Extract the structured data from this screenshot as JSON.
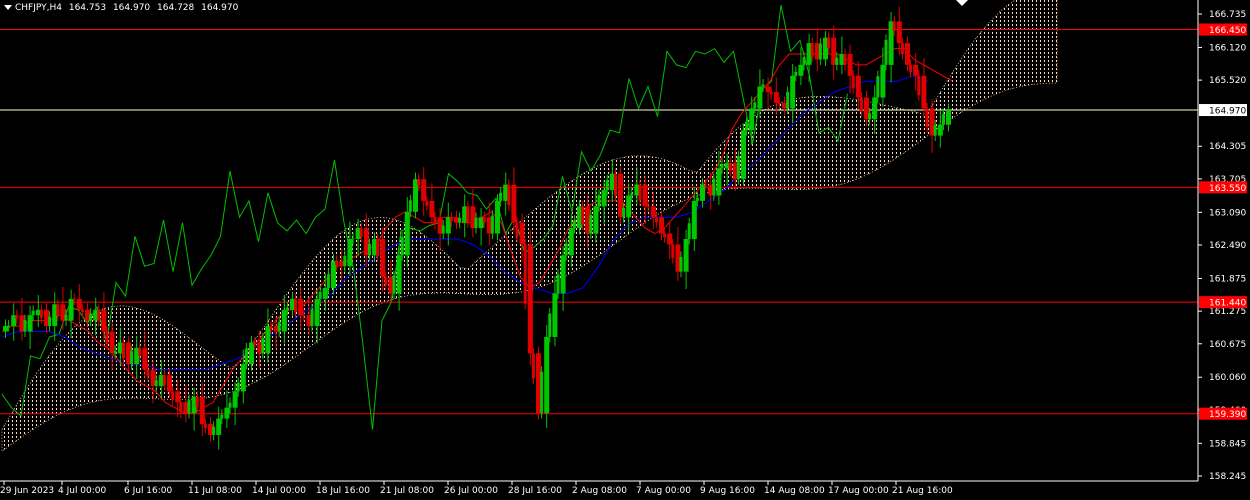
{
  "header": {
    "symbol": "CHFJPY,H4",
    "open": "164.753",
    "high": "164.970",
    "low": "164.728",
    "close": "164.970"
  },
  "colors": {
    "background": "#000000",
    "axis": "#ffffff",
    "bull_candle": "#00c800",
    "bear_candle": "#e00000",
    "tenkan_sen": "#ff0000",
    "kijun_sen": "#0000ff",
    "chikou_span": "#00c000",
    "cloud": "#ffd8b8",
    "hline": "#ff0000",
    "price_line": "#ffffcc"
  },
  "icons": {
    "menu": "triangle-down-icon",
    "shift": "triangle-down-icon"
  },
  "chart_data": {
    "type": "candlestick",
    "symbol": "CHFJPY",
    "timeframe": "H4",
    "indicator": "ichimoku",
    "ylim": [
      158.245,
      166.9
    ],
    "y_ticks": [
      "166.735",
      "166.120",
      "165.520",
      "164.305",
      "163.705",
      "163.090",
      "162.490",
      "161.875",
      "161.275",
      "160.675",
      "160.060",
      "159.460",
      "158.845",
      "158.245"
    ],
    "x_ticks": [
      "29 Jun 2023",
      "4 Jul 00:00",
      "6 Jul 16:00",
      "11 Jul 08:00",
      "14 Jul 00:00",
      "18 Jul 16:00",
      "21 Jul 08:00",
      "26 Jul 00:00",
      "28 Jul 16:00",
      "2 Aug 08:00",
      "7 Aug 00:00",
      "9 Aug 16:00",
      "14 Aug 08:00",
      "17 Aug 00:00",
      "21 Aug 16:00"
    ],
    "hlines": [
      {
        "value": 166.45,
        "label": "166.450",
        "color": "#ff0000"
      },
      {
        "value": 163.55,
        "label": "163.550",
        "color": "#ff0000"
      },
      {
        "value": 161.44,
        "label": "161.440",
        "color": "#ff0000"
      },
      {
        "value": 159.39,
        "label": "159.390",
        "color": "#ff0000"
      }
    ],
    "current_price": {
      "value": 164.97,
      "label": "164.970"
    },
    "closes": [
      161.0,
      161.2,
      160.9,
      161.2,
      161.3,
      161.0,
      161.4,
      161.1,
      161.5,
      161.3,
      161.1,
      161.3,
      160.9,
      160.5,
      160.7,
      160.3,
      160.6,
      160.2,
      159.9,
      160.1,
      159.8,
      159.6,
      159.4,
      159.7,
      159.2,
      159.0,
      159.3,
      159.5,
      159.8,
      160.3,
      160.7,
      160.5,
      161.0,
      160.9,
      161.3,
      161.5,
      161.2,
      161.0,
      161.5,
      161.7,
      162.2,
      162.1,
      162.6,
      162.8,
      162.3,
      162.6,
      161.9,
      161.6,
      162.3,
      163.1,
      163.7,
      163.3,
      163.0,
      162.7,
      163.0,
      162.9,
      163.2,
      162.8,
      163.0,
      162.7,
      163.3,
      163.6,
      162.9,
      162.5,
      160.5,
      159.4,
      160.8,
      161.6,
      162.3,
      162.8,
      163.2,
      162.7,
      163.2,
      163.5,
      163.8,
      163.0,
      163.4,
      163.6,
      163.2,
      163.0,
      162.7,
      162.5,
      162.0,
      162.6,
      163.3,
      163.6,
      163.4,
      163.9,
      164.0,
      163.7,
      164.6,
      165.0,
      165.4,
      165.3,
      165.1,
      165.0,
      165.6,
      165.8,
      166.2,
      165.9,
      166.3,
      165.8,
      166.0,
      165.6,
      165.2,
      164.8,
      165.2,
      165.8,
      166.6,
      166.2,
      165.8,
      165.6,
      165.0,
      164.5,
      164.7,
      164.97
    ],
    "tenkan": [
      160.9,
      161.0,
      161.0,
      161.1,
      161.1,
      161.1,
      161.2,
      161.1,
      161.0,
      160.9,
      160.7,
      160.6,
      160.4,
      160.2,
      160.0,
      159.9,
      159.8,
      159.6,
      159.5,
      159.4,
      159.4,
      159.5,
      159.6,
      159.9,
      160.2,
      160.4,
      160.6,
      160.8,
      161.0,
      161.2,
      161.3,
      161.3,
      161.5,
      161.7,
      161.9,
      162.1,
      162.2,
      162.3,
      162.4,
      162.5,
      162.8,
      163.0,
      163.1,
      163.0,
      162.9,
      162.9,
      163.0,
      163.0,
      162.9,
      162.9,
      163.0,
      163.1,
      162.9,
      162.4,
      161.9,
      161.7,
      161.8,
      162.1,
      162.4,
      162.8,
      163.0,
      163.2,
      163.3,
      163.3,
      163.3,
      163.2,
      163.0,
      162.8,
      162.7,
      162.8,
      163.0,
      163.2,
      163.4,
      163.6,
      163.8,
      164.1,
      164.6,
      164.9,
      165.1,
      165.3,
      165.5,
      165.8,
      166.0,
      166.0,
      166.0,
      166.0,
      166.0,
      166.0,
      165.9,
      165.8,
      165.8,
      165.9,
      166.0,
      166.1,
      166.1,
      165.9,
      165.8,
      165.7,
      165.6,
      165.5
    ],
    "kijun": [
      160.8,
      160.9,
      160.9,
      160.9,
      160.8,
      160.6,
      160.5,
      160.4,
      160.3,
      160.3,
      160.2,
      160.2,
      160.2,
      160.2,
      160.3,
      160.4,
      160.6,
      160.8,
      161.0,
      161.2,
      161.4,
      161.6,
      161.9,
      162.1,
      162.3,
      162.5,
      162.6,
      162.6,
      162.6,
      162.6,
      162.5,
      162.3,
      162.0,
      161.8,
      161.7,
      161.6,
      161.6,
      161.7,
      162.1,
      162.6,
      162.9,
      163.0,
      163.0,
      163.0,
      163.1,
      163.3,
      163.5,
      163.8,
      164.0,
      164.3,
      164.6,
      164.9,
      165.1,
      165.3,
      165.4,
      165.5,
      165.5,
      165.5,
      165.6,
      165.5
    ],
    "cloud_note": "Ichimoku cloud shown as dotted band"
  }
}
